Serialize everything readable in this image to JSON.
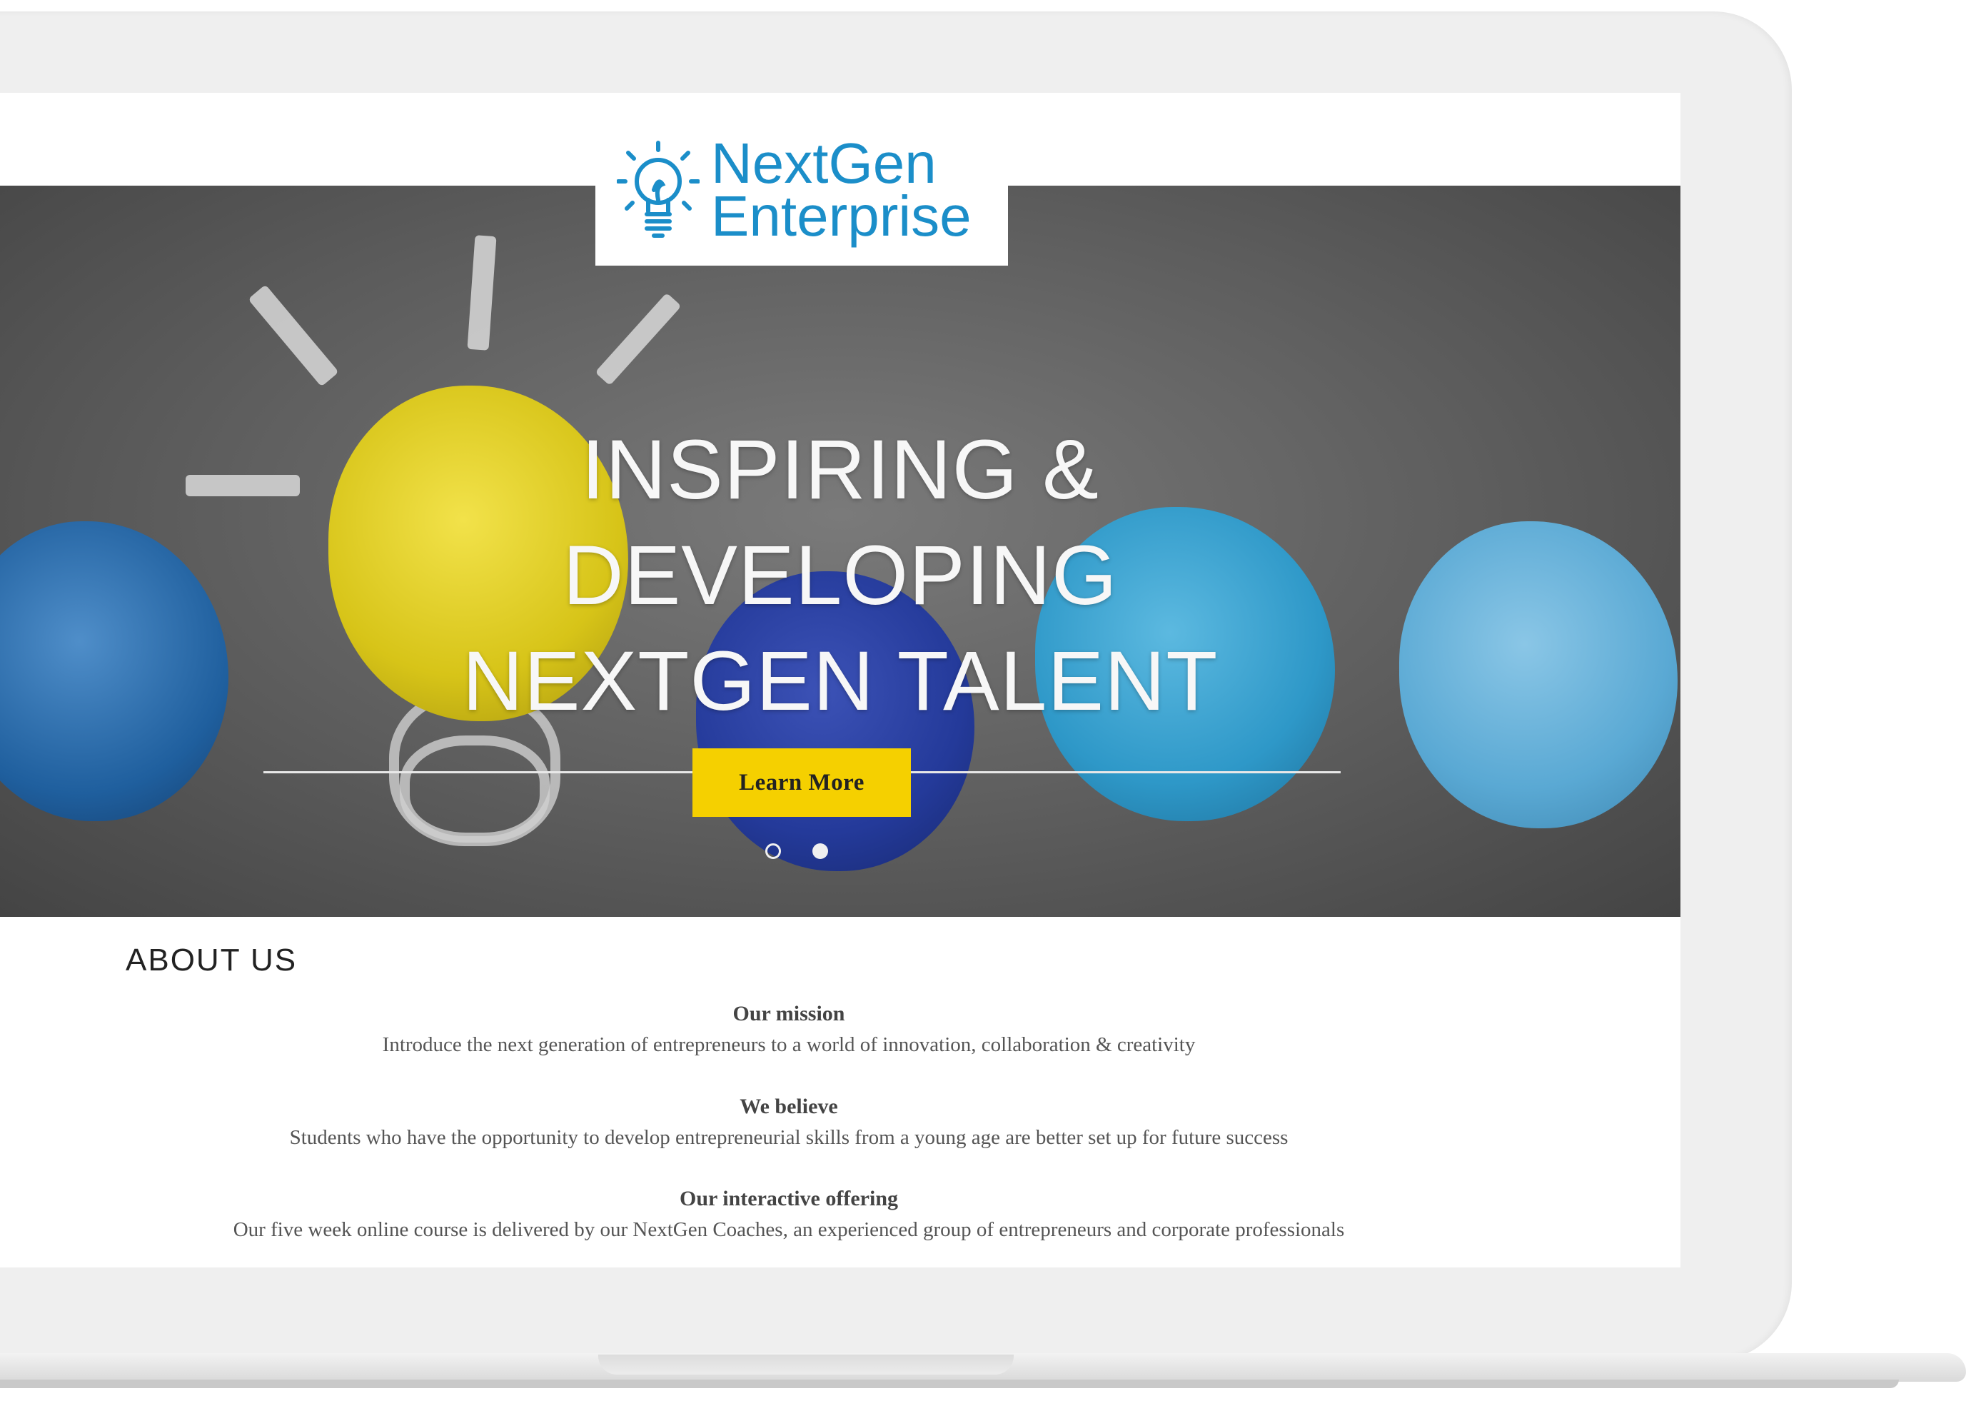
{
  "logo": {
    "line1": "NextGen",
    "line2": "Enterprise",
    "color": "#1b8ec9"
  },
  "hero": {
    "title_lines": [
      "INSPIRING &",
      "DEVELOPING",
      "NEXTGEN TALENT"
    ],
    "cta_label": "Learn More",
    "cta_color": "#f5d000",
    "slides": {
      "count": 2,
      "active": 2
    }
  },
  "about": {
    "heading": "ABOUT US",
    "blocks": [
      {
        "title": "Our mission",
        "text": "Introduce the next generation of entrepreneurs to a world of innovation, collaboration & creativity"
      },
      {
        "title": "We believe",
        "text": "Students who have the opportunity to develop entrepreneurial skills from a young age are better set up for future success"
      },
      {
        "title": "Our interactive offering",
        "text": "Our five week online course is delivered by our NextGen Coaches, an experienced group of entrepreneurs and corporate professionals"
      }
    ]
  }
}
